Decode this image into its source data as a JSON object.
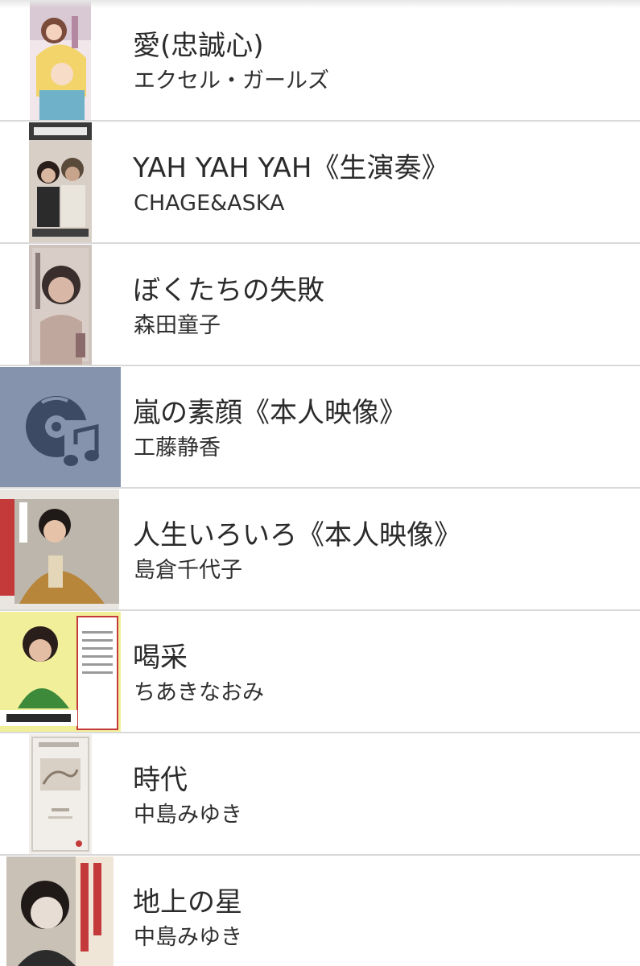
{
  "songs": [
    {
      "title": "愛(忠誠心)",
      "artist": "エクセル・ガールズ",
      "thumb": "anime-cover-art"
    },
    {
      "title": "YAH YAH YAH《生演奏》",
      "artist": "CHAGE&ASKA",
      "thumb": "duo-cover-art"
    },
    {
      "title": "ぼくたちの失敗",
      "artist": "森田童子",
      "thumb": "portrait-cover-art"
    },
    {
      "title": "嵐の素顔《本人映像》",
      "artist": "工藤静香",
      "thumb": "music-disc-icon"
    },
    {
      "title": "人生いろいろ《本人映像》",
      "artist": "島倉千代子",
      "thumb": "kimono-cover-art"
    },
    {
      "title": "喝采",
      "artist": "ちあきなおみ",
      "thumb": "green-dress-cover-art"
    },
    {
      "title": "時代",
      "artist": "中島みゆき",
      "thumb": "sketch-cover-art"
    },
    {
      "title": "地上の星",
      "artist": "中島みゆき",
      "thumb": "bw-portrait-cover-art"
    }
  ],
  "colors": {
    "placeholder_bg": "#8593ad",
    "placeholder_icon": "#3d4a63",
    "divider": "#d9d9d9",
    "text": "#2b2b2b"
  }
}
